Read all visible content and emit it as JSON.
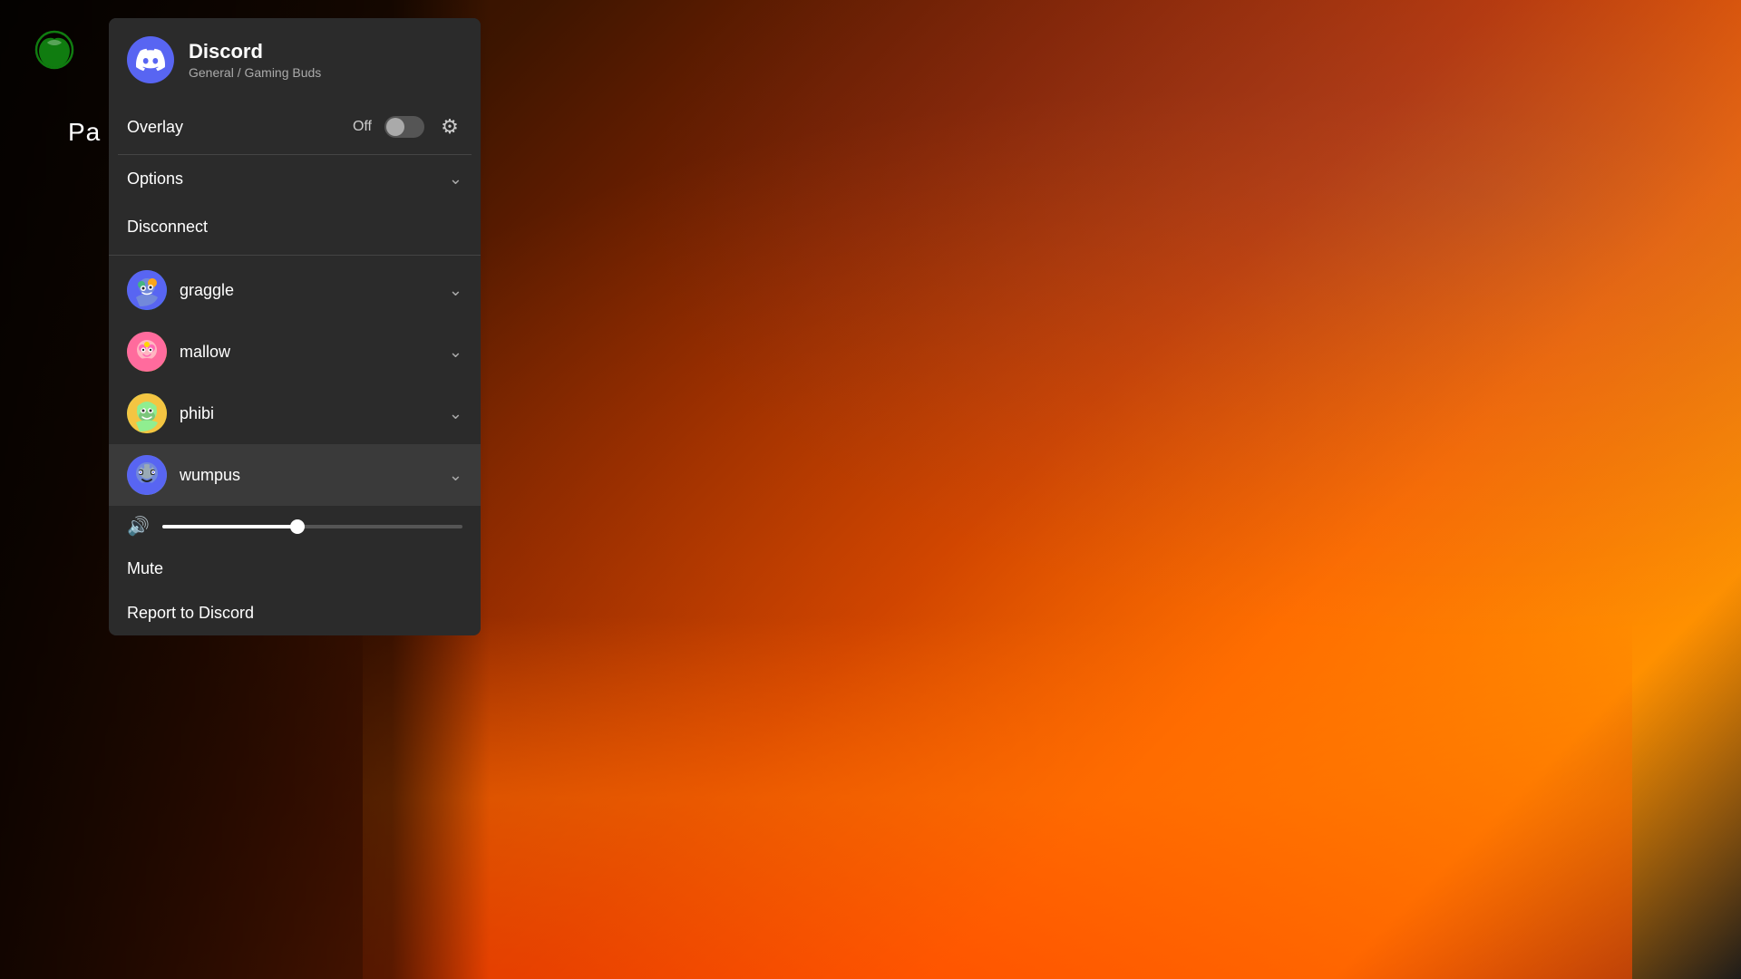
{
  "app": {
    "title": "Discord",
    "subtitle": "General / Gaming Buds"
  },
  "overlay": {
    "label": "Overlay",
    "status": "Off",
    "toggle_state": false
  },
  "menu": {
    "options_label": "Options",
    "disconnect_label": "Disconnect"
  },
  "users": [
    {
      "id": "graggle",
      "name": "graggle",
      "avatar_emoji": "😀",
      "expanded": false
    },
    {
      "id": "mallow",
      "name": "mallow",
      "avatar_emoji": "🌸",
      "expanded": false
    },
    {
      "id": "phibi",
      "name": "phibi",
      "avatar_emoji": "🐸",
      "expanded": false
    },
    {
      "id": "wumpus",
      "name": "wumpus",
      "avatar_emoji": "🤖",
      "expanded": true
    }
  ],
  "volume": {
    "icon": "🔊",
    "value": 45
  },
  "actions": {
    "mute_label": "Mute",
    "report_label": "Report to Discord"
  },
  "sidebar": {
    "page_label": "Pa"
  }
}
